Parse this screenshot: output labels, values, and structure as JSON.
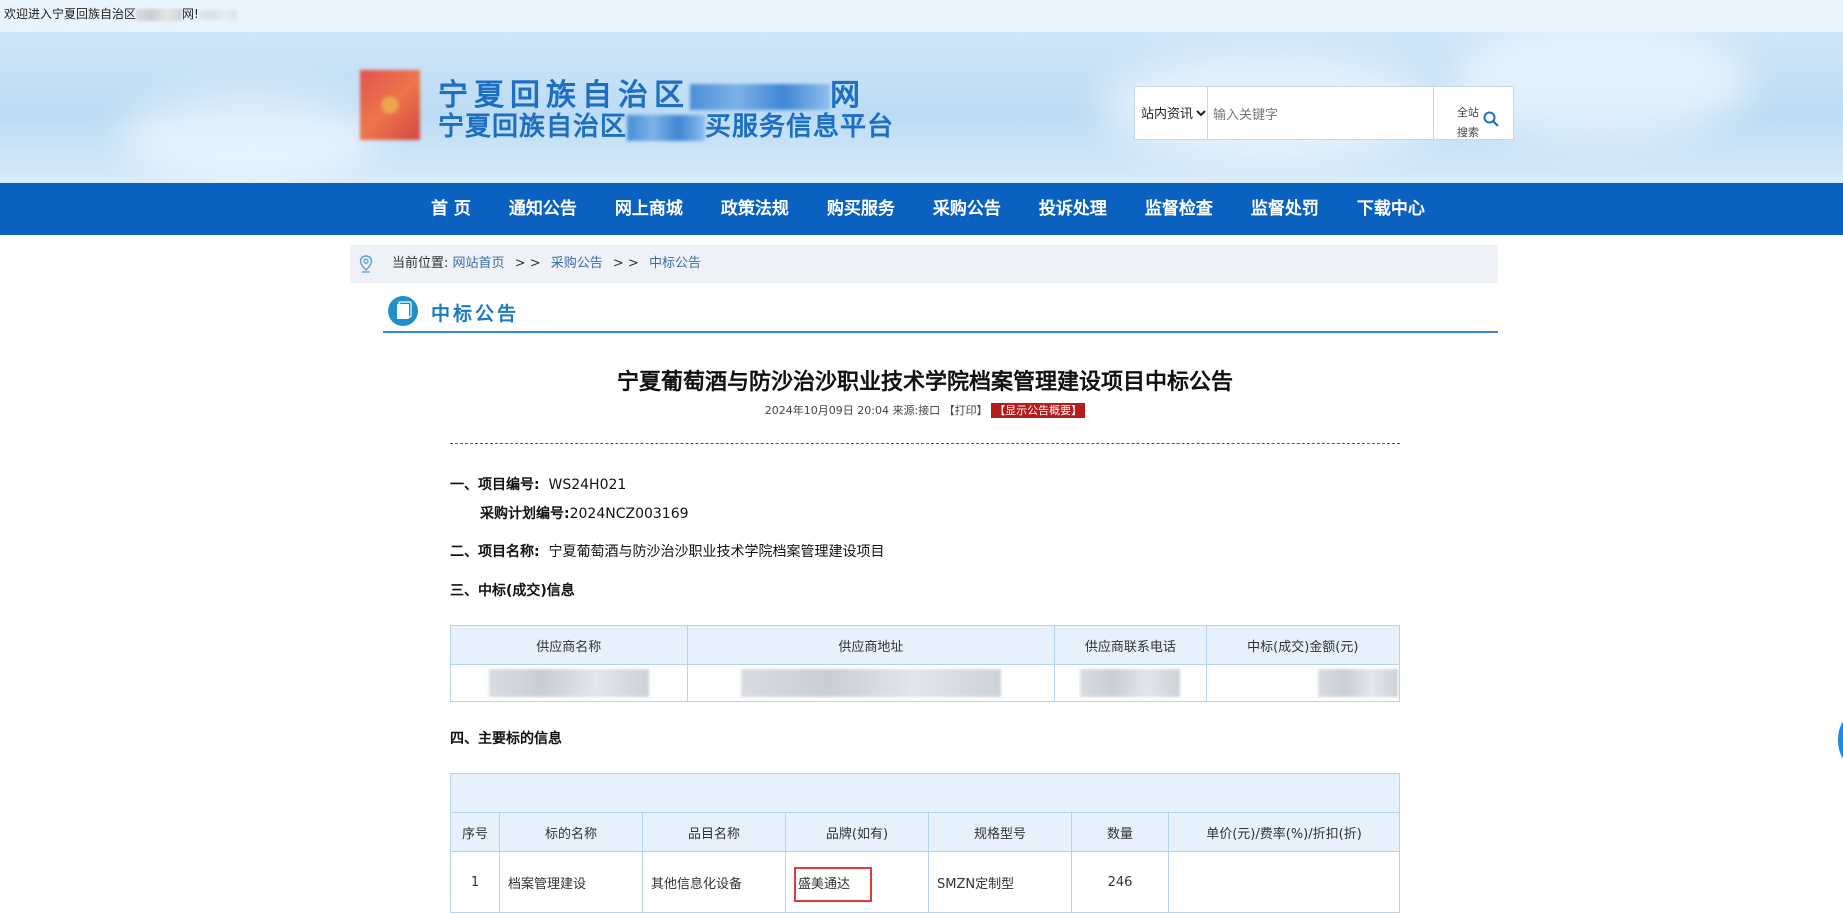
{
  "topbar": {
    "welcome_prefix": "欢迎进入宁夏回族自治区",
    "welcome_suffix": "网!"
  },
  "header": {
    "title_line1_prefix": "宁夏回族自治区",
    "title_line1_suffix": "网",
    "title_line2_prefix": "宁夏回族自治区",
    "title_line2_suffix": "买服务信息平台"
  },
  "search": {
    "scope_selected": "站内资讯",
    "placeholder": "输入关键字",
    "button_line1": "全站",
    "button_line2": "搜索"
  },
  "nav": {
    "items": [
      "首 页",
      "通知公告",
      "网上商城",
      "政策法规",
      "购买服务",
      "采购公告",
      "投诉处理",
      "监督检查",
      "监督处罚",
      "下载中心"
    ]
  },
  "breadcrumb": {
    "label": "当前位置:",
    "items": [
      "网站首页",
      "采购公告",
      "中标公告"
    ],
    "separator": "> >"
  },
  "section": {
    "title": "中标公告"
  },
  "article": {
    "title": "宁夏葡萄酒与防沙治沙职业技术学院档案管理建设项目中标公告",
    "meta": "2024年10月09日 20:04 来源:接口 【打印】",
    "summary_tag": "【显示公告概要】",
    "s1_label": "一、项目编号:",
    "s1_value": "WS24H021",
    "s1b_label": "采购计划编号:",
    "s1b_value": "2024NCZ003169",
    "s2_label": "二、项目名称:",
    "s2_value": "宁夏葡萄酒与防沙治沙职业技术学院档案管理建设项目",
    "s3_label": "三、中标(成交)信息",
    "s4_label": "四、主要标的信息"
  },
  "winner_table": {
    "headers": [
      "供应商名称",
      "供应商地址",
      "供应商联系电话",
      "中标(成交)金额(元)"
    ]
  },
  "item_table": {
    "headers": [
      "序号",
      "标的名称",
      "品目名称",
      "品牌(如有)",
      "规格型号",
      "数量",
      "单价(元)/费率(%)/折扣(折)"
    ],
    "rows": [
      [
        "1",
        "档案管理建设",
        "其他信息化设备",
        "盛美通达",
        "SMZN定制型",
        "246",
        ""
      ]
    ]
  }
}
